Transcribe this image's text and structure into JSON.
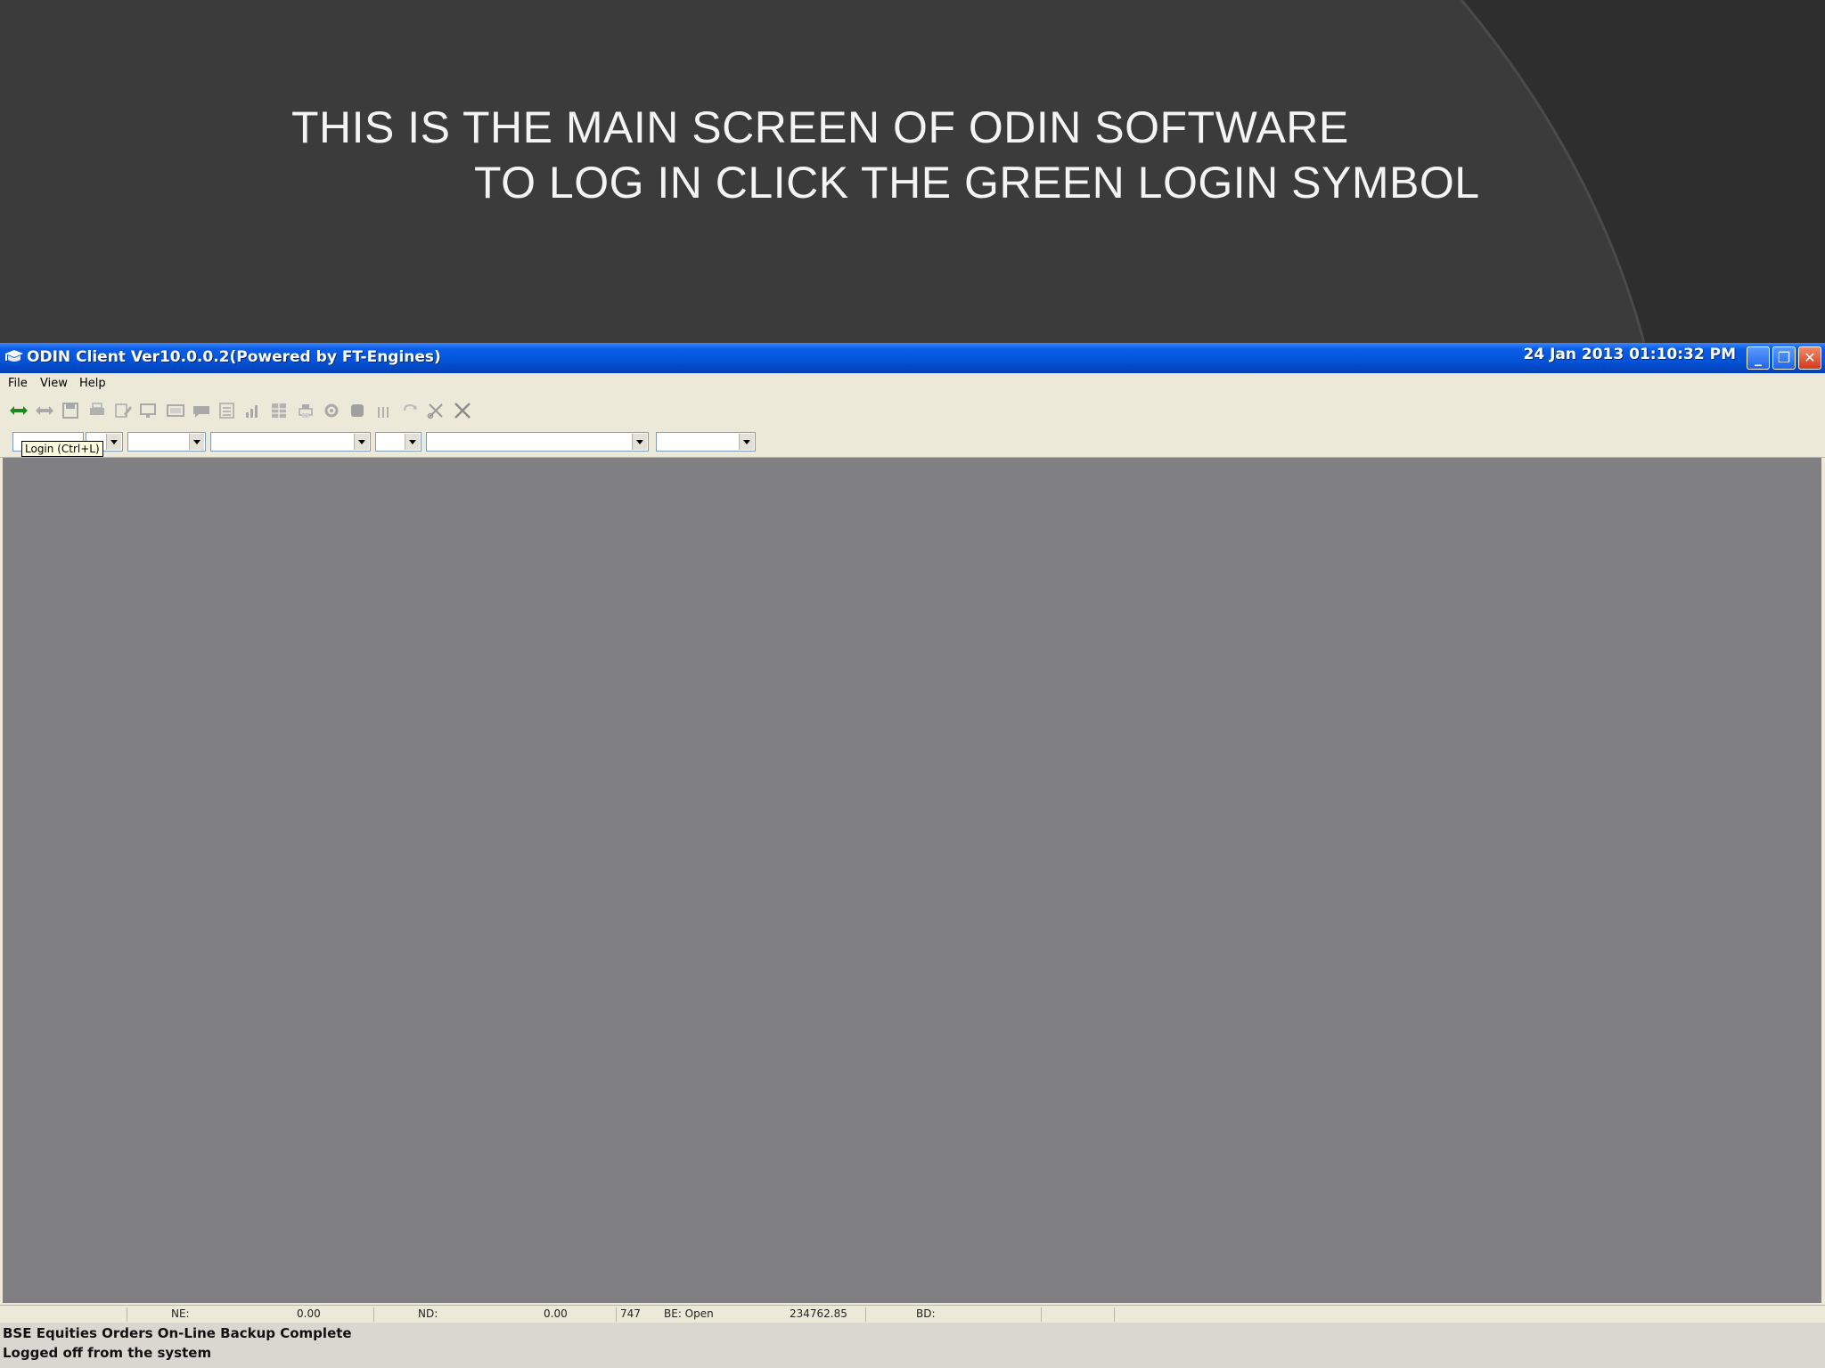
{
  "slide": {
    "caption_line1": "THIS IS THE MAIN SCREEN OF ODIN SOFTWARE",
    "caption_line2": "TO LOG IN CLICK THE GREEN LOGIN SYMBOL"
  },
  "window": {
    "title": "ODIN Client Ver10.0.0.2(Powered by FT-Engines)",
    "datetime": "24 Jan 2013  01:10:32 PM",
    "minimize_glyph": "_",
    "restore_glyph": "❐",
    "close_glyph": "✕"
  },
  "menu": {
    "file": "File",
    "view": "View",
    "help": "Help"
  },
  "toolbar": {
    "login_tooltip": "Login (Ctrl+L)",
    "icons": [
      "login-icon",
      "logout-icon",
      "save-icon",
      "print-icon",
      "edit-icon",
      "monitor-icon",
      "window-icon",
      "message-icon",
      "report-icon",
      "chart-icon",
      "table-icon",
      "printer-icon",
      "settings-icon",
      "stop-icon",
      "bars-icon",
      "refresh-icon",
      "cut-icon",
      "close-x-icon"
    ]
  },
  "status": {
    "ne_label": "NE:",
    "ne_value": "0.00",
    "nd_label": "ND:",
    "nd_value": "0.00",
    "count": "747",
    "be_status": "BE: Open",
    "be_value": "234762.85",
    "bd_label": "BD:"
  },
  "messages": {
    "line1": "BSE Equities Orders On-Line Backup Complete",
    "line2": "Logged off from the system"
  },
  "colors": {
    "slide_bg": "#3b3b3b",
    "title_bar": "#0453d8",
    "workspace": "#807f82",
    "login_icon": "#1a8a1a"
  }
}
